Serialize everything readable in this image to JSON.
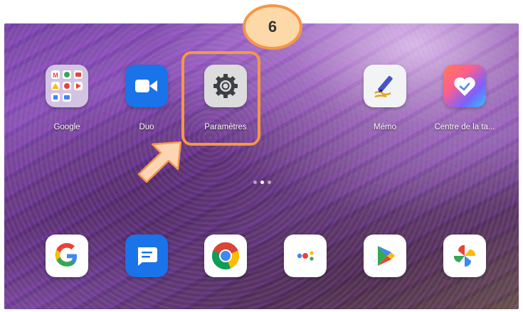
{
  "home_screen": {
    "top_row": [
      {
        "label": "Google",
        "icon": "google-folder-icon"
      },
      {
        "label": "Duo",
        "icon": "duo-video-icon"
      },
      {
        "label": "Paramètres",
        "icon": "settings-gear-icon"
      },
      {
        "label": "Mémo",
        "icon": "memo-pen-icon"
      },
      {
        "label": "Centre de la ta...",
        "icon": "heart-center-icon"
      }
    ],
    "dock": [
      {
        "name": "google",
        "icon": "google-g-icon"
      },
      {
        "name": "messages",
        "icon": "messages-icon"
      },
      {
        "name": "chrome",
        "icon": "chrome-icon"
      },
      {
        "name": "assistant",
        "icon": "assistant-dots-icon"
      },
      {
        "name": "play-store",
        "icon": "play-store-icon"
      },
      {
        "name": "photos",
        "icon": "photos-pinwheel-icon"
      }
    ],
    "page_indicator": {
      "pages": 3,
      "active": 2
    }
  },
  "annotation": {
    "step_number": "6",
    "highlight_target": "Paramètres",
    "accent_color": "#f79646",
    "badge_fill": "#fdd8a8"
  }
}
